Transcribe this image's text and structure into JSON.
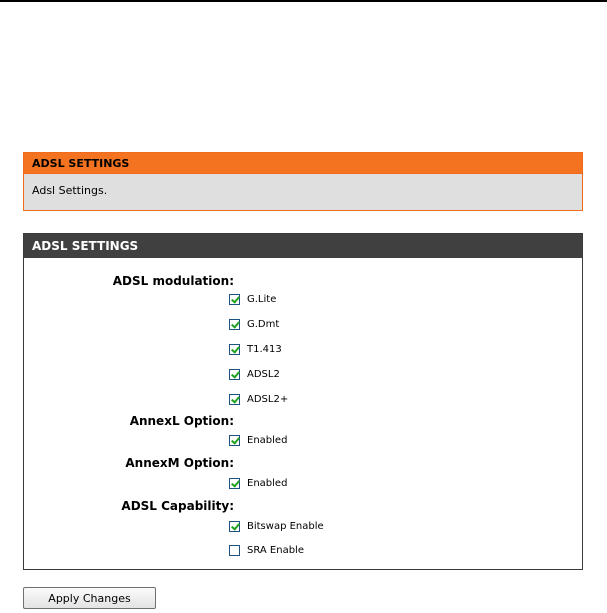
{
  "info_panel": {
    "title": "ADSL SETTINGS",
    "description": "Adsl Settings."
  },
  "settings_panel": {
    "title": "ADSL SETTINGS",
    "modulation_label": "ADSL modulation:",
    "modulation_options": [
      {
        "label": "G.Lite",
        "checked": true
      },
      {
        "label": "G.Dmt",
        "checked": true
      },
      {
        "label": "T1.413",
        "checked": true
      },
      {
        "label": "ADSL2",
        "checked": true
      },
      {
        "label": "ADSL2+",
        "checked": true
      }
    ],
    "annexl_label": "AnnexL Option:",
    "annexl_option": {
      "label": "Enabled",
      "checked": true
    },
    "annexm_label": "AnnexM Option:",
    "annexm_option": {
      "label": "Enabled",
      "checked": true
    },
    "capability_label": "ADSL Capability:",
    "capability_options": [
      {
        "label": "Bitswap Enable",
        "checked": true
      },
      {
        "label": "SRA Enable",
        "checked": false
      }
    ]
  },
  "apply_button": "Apply Changes",
  "colors": {
    "orange_header": "#f47321",
    "dark_header": "#404040",
    "check_green": "#21a121"
  }
}
